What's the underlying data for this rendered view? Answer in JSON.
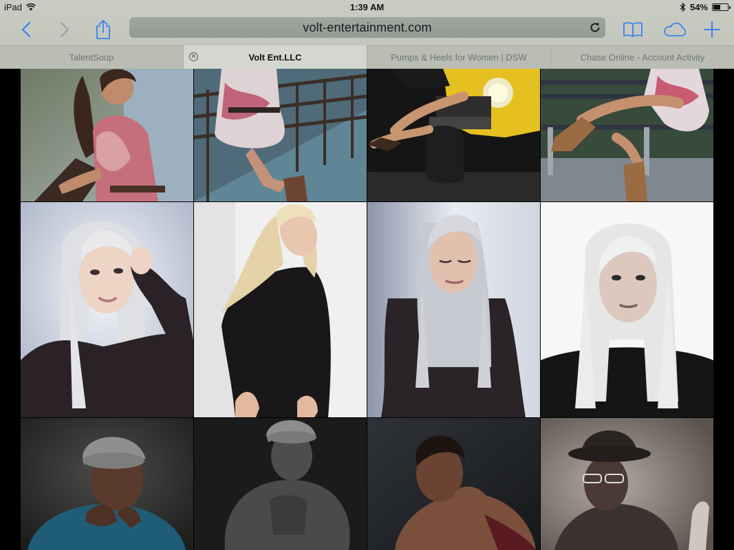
{
  "status_bar": {
    "device": "iPad",
    "time": "1:39 AM",
    "battery_label": "54%",
    "battery_fraction": 0.54
  },
  "toolbar": {
    "back_icon": "chevron-left-icon",
    "forward_icon": "chevron-right-icon",
    "share_icon": "share-icon",
    "url": "volt-entertainment.com",
    "reload_icon": "reload-icon",
    "bookmarks_icon": "book-icon",
    "cloud_icon": "cloud-icon",
    "new_tab_icon": "plus-icon",
    "accent": "#3b82f0"
  },
  "tabs": [
    {
      "label": "TalentSoup",
      "active": false
    },
    {
      "label": "Volt Ent.LLC",
      "active": true
    },
    {
      "label": "Pumps & Heels for Women | DSW",
      "active": false
    },
    {
      "label": "Chase Online - Account Activity",
      "active": false
    }
  ],
  "gallery": {
    "rows": [
      [
        "photo-woman-floral-dress-sitting",
        "photo-woman-floral-dress-bridge",
        "photo-legs-yellow-jeep",
        "photo-woman-boots-bench"
      ],
      [
        "photo-blonde-hand-in-hair",
        "photo-blonde-leaning-wall",
        "photo-blonde-eyes-closed",
        "photo-blonde-portrait-bw"
      ],
      [
        "photo-man-flat-cap-blue-sweater",
        "photo-man-cap-shirtless",
        "photo-man-shirtless-profile",
        "photo-man-fedora-glasses"
      ]
    ]
  }
}
